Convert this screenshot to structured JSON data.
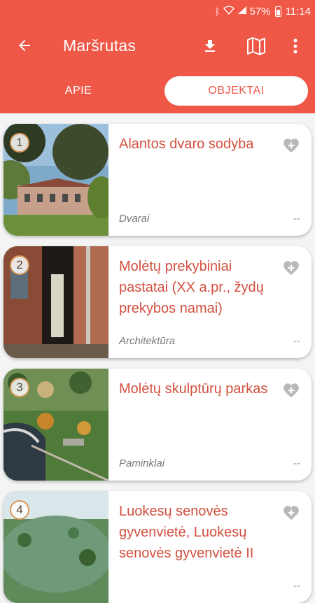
{
  "status_bar": {
    "battery": "57%",
    "time": "11:14"
  },
  "app_bar": {
    "title": "Maršrutas",
    "back_icon": "arrow-left-icon",
    "actions": [
      "download-icon",
      "map-icon",
      "more-vert-icon"
    ]
  },
  "tabs": [
    {
      "label": "APIE",
      "selected": false
    },
    {
      "label": "OBJEKTAI",
      "selected": true
    }
  ],
  "colors": {
    "accent": "#ef5747",
    "title_text": "#d2503f",
    "number_ring": "#d9985a"
  },
  "objects": [
    {
      "number": "1",
      "title": "Alantos dvaro sodyba",
      "category": "Dvarai",
      "distance": "--"
    },
    {
      "number": "2",
      "title": "Molėtų prekybiniai pastatai (XX a.pr., žydų prekybos namai)",
      "category": "Architektūra",
      "distance": "--"
    },
    {
      "number": "3",
      "title": "Molėtų skulptūrų parkas",
      "category": "Paminklai",
      "distance": "--"
    },
    {
      "number": "4",
      "title": "Luokesų senovės gyvenvietė, Luokesų senovės gyvenvietė II",
      "category": "",
      "distance": "--"
    }
  ]
}
